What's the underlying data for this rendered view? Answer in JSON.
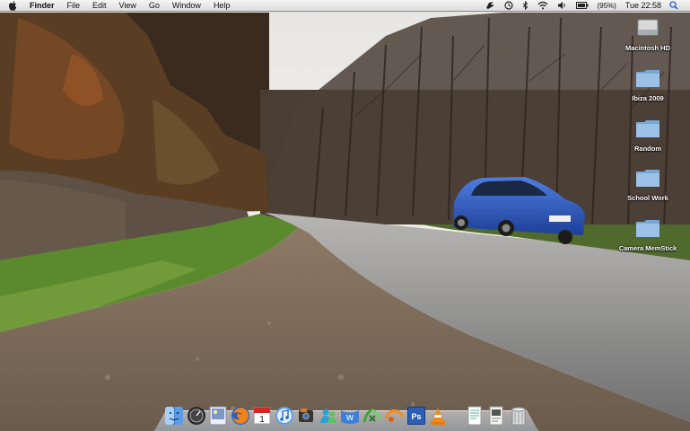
{
  "menubar": {
    "app_name": "Finder",
    "menus": [
      "File",
      "Edit",
      "View",
      "Go",
      "Window",
      "Help"
    ],
    "battery_percent": "(95%)",
    "clock": "Tue 22:58",
    "status_icons": [
      "script-icon",
      "time-machine-icon",
      "bluetooth-icon",
      "wifi-icon",
      "volume-icon",
      "battery-icon",
      "spotlight-icon"
    ]
  },
  "desktop": {
    "icons": [
      {
        "label": "Macintosh HD",
        "icon": "hard-drive-icon"
      },
      {
        "label": "Ibiza 2009",
        "icon": "folder-icon"
      },
      {
        "label": "Random",
        "icon": "folder-icon"
      },
      {
        "label": "School Work",
        "icon": "folder-icon"
      },
      {
        "label": "Camera MemStick",
        "icon": "folder-icon"
      }
    ]
  },
  "dock": {
    "items": [
      "finder-icon",
      "dashboard-icon",
      "preview-icon",
      "firefox-icon",
      "ical-icon",
      "itunes-icon",
      "iphoto-icon",
      "messenger-icon",
      "word-icon",
      "excel-icon",
      "powerpoint-icon",
      "photoshop-icon",
      "vlc-icon",
      "document-icon",
      "document-icon",
      "trash-icon"
    ],
    "ical_day": "1",
    "word_letter": "w",
    "photoshop_label": "Ps"
  },
  "colors": {
    "sky": "#f4f1ea",
    "road": "#8f8e8c",
    "car": "#2d55b4",
    "grass": "#5b8a2e",
    "folder": "#8ab4dc"
  }
}
